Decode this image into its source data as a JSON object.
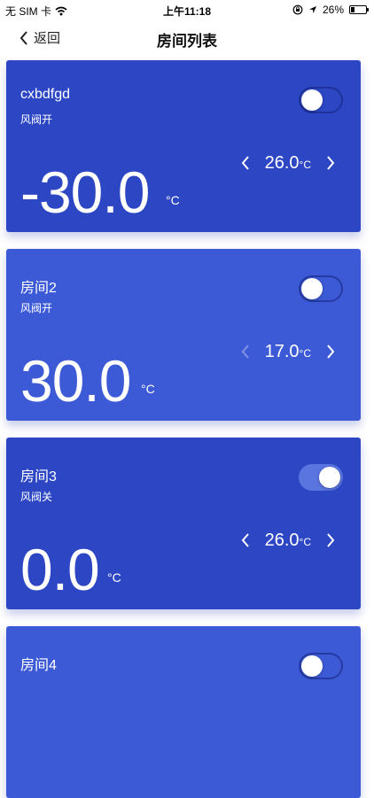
{
  "status_bar": {
    "carrier": "无 SIM 卡",
    "time": "上午11:18",
    "battery": "26%",
    "battery_level": 0.26
  },
  "nav": {
    "back_label": "返回",
    "title": "房间列表"
  },
  "rooms": [
    {
      "name": "cxbdfgd",
      "valve": "风阀开",
      "temperature": "-30.0",
      "setpoint": "26.0",
      "unit": "°C",
      "on": false,
      "color": "#2c46c4",
      "left_arrow_dim": false
    },
    {
      "name": "房间2",
      "valve": "风阀开",
      "temperature": "30.0",
      "setpoint": "17.0",
      "unit": "°C",
      "on": false,
      "color": "#3d5ad6",
      "left_arrow_dim": true
    },
    {
      "name": "房间3",
      "valve": "风阀关",
      "temperature": "0.0",
      "setpoint": "26.0",
      "unit": "°C",
      "on": true,
      "color": "#2c46c4",
      "left_arrow_dim": false
    },
    {
      "name": "房间4",
      "color": "#3d5ad6",
      "on": false
    }
  ]
}
